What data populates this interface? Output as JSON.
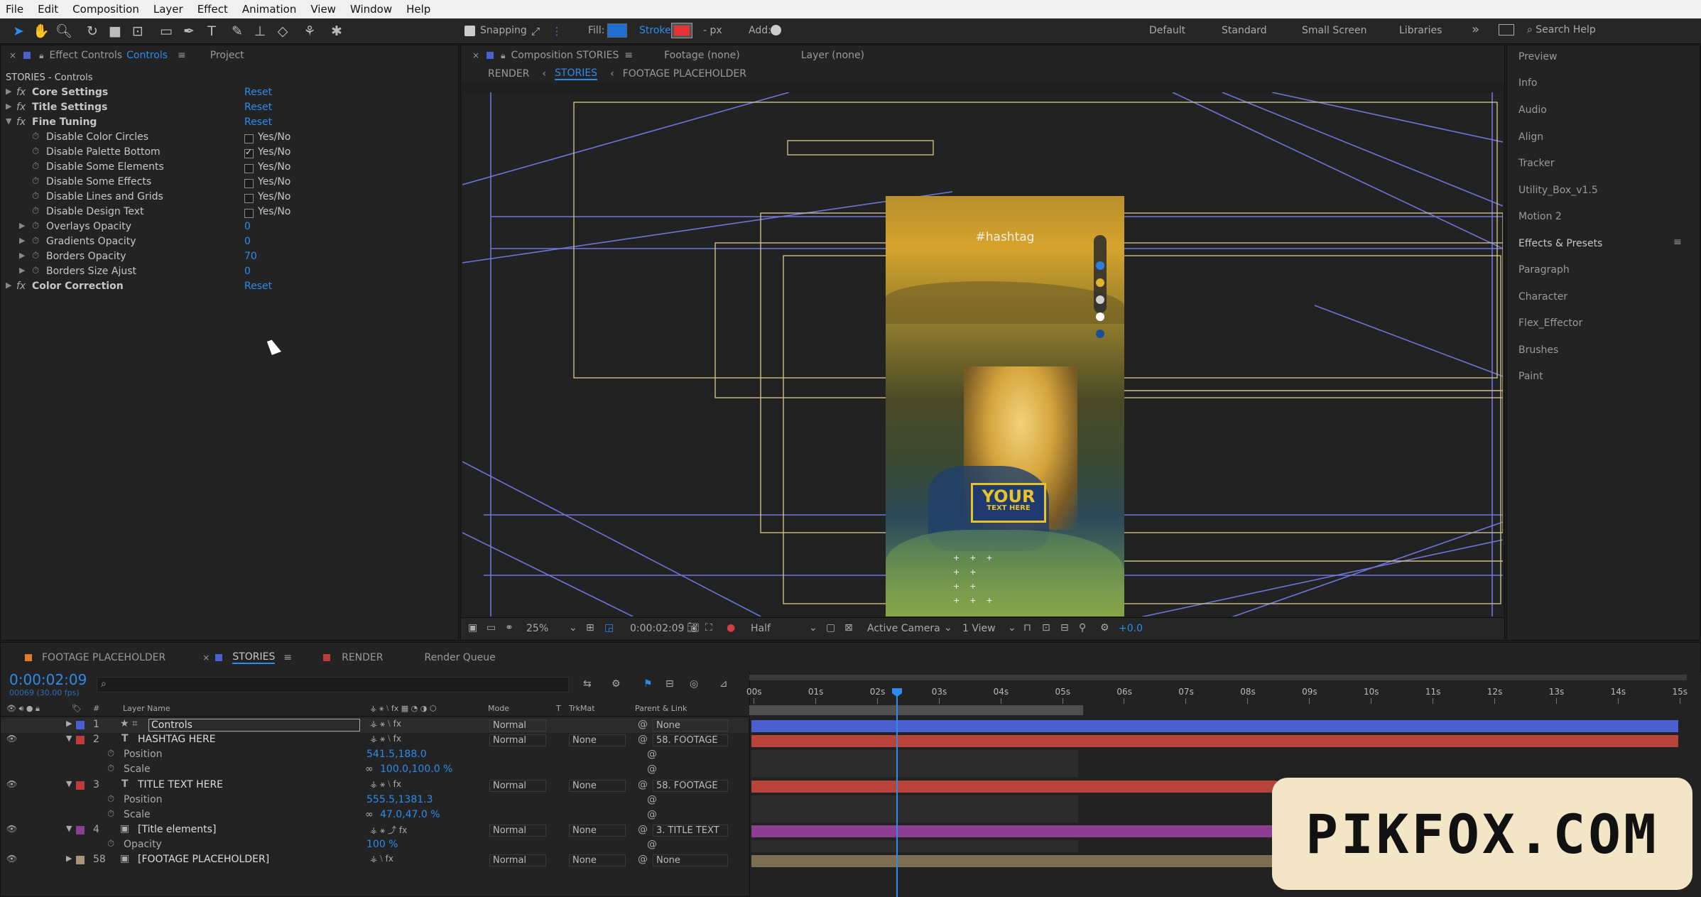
{
  "menu": [
    "File",
    "Edit",
    "Composition",
    "Layer",
    "Effect",
    "Animation",
    "View",
    "Window",
    "Help"
  ],
  "toolbar": {
    "snapping": "Snapping",
    "fill": "Fill:",
    "stroke": "Stroke:",
    "px": "- px",
    "add": "Add:",
    "workspaces": [
      "Default",
      "Standard",
      "Small Screen",
      "Libraries"
    ],
    "search": "Search Help"
  },
  "effect_controls": {
    "tab_prefix": "Effect Controls",
    "tab_name": "Controls",
    "project_tab": "Project",
    "path": "STORIES - Controls",
    "rows": [
      {
        "label": "Core Settings",
        "value": "Reset"
      },
      {
        "label": "Title Settings",
        "value": "Reset"
      },
      {
        "label": "Fine Tuning",
        "value": "Reset"
      },
      {
        "label": "Disable Color Circles",
        "value": "Yes/No"
      },
      {
        "label": "Disable Palette Bottom",
        "value": "Yes/No"
      },
      {
        "label": "Disable Some Elements",
        "value": "Yes/No"
      },
      {
        "label": "Disable Some Effects",
        "value": "Yes/No"
      },
      {
        "label": "Disable Lines and Grids",
        "value": "Yes/No"
      },
      {
        "label": "Disable Design Text",
        "value": "Yes/No"
      },
      {
        "label": "Overlays Opacity",
        "value": "0"
      },
      {
        "label": "Gradients Opacity",
        "value": "0"
      },
      {
        "label": "Borders Opacity",
        "value": "70"
      },
      {
        "label": "Borders Size Ajust",
        "value": "0"
      },
      {
        "label": "Color Correction",
        "value": "Reset"
      }
    ]
  },
  "composition": {
    "tab": "Composition STORIES",
    "footage": "Footage (none)",
    "layer": "Layer (none)",
    "crumbs": [
      "RENDER",
      "STORIES",
      "FOOTAGE PLACEHOLDER"
    ],
    "hashtag": "#hashtag",
    "your": "YOUR",
    "text_here": "TEXT HERE",
    "bottom": {
      "zoom": "25%",
      "time": "0:00:02:09",
      "res": "Half",
      "camera": "Active Camera",
      "view": "1 View",
      "exposure": "+0.0"
    }
  },
  "right_panel": [
    "Preview",
    "Info",
    "Audio",
    "Align",
    "Tracker",
    "Utility_Box_v1.5",
    "Motion 2",
    "Effects & Presets",
    "Paragraph",
    "Character",
    "Flex_Effector",
    "Brushes",
    "Paint"
  ],
  "timeline": {
    "tabs": [
      "FOOTAGE PLACEHOLDER",
      "STORIES",
      "RENDER",
      "Render Queue"
    ],
    "timecode": "0:00:02:09",
    "frames": "00069 (30.00 fps)",
    "headers": {
      "num": "#",
      "layer": "Layer Name",
      "mode": "Mode",
      "t": "T",
      "trkmat": "TrkMat",
      "parent": "Parent & Link"
    },
    "ruler": [
      "00s",
      "01s",
      "02s",
      "03s",
      "04s",
      "05s",
      "06s",
      "07s",
      "08s",
      "09s",
      "10s",
      "11s",
      "12s",
      "13s",
      "14s",
      "15s"
    ],
    "layers": [
      {
        "num": "1",
        "name": "Controls",
        "mode": "Normal",
        "trk": "",
        "parent": "None"
      },
      {
        "num": "2",
        "name": "HASHTAG HERE",
        "mode": "Normal",
        "trk": "None",
        "parent": "58. FOOTAGE"
      },
      {
        "prop": "Position",
        "value": "541.5,188.0"
      },
      {
        "prop": "Scale",
        "value": "100.0,100.0 %"
      },
      {
        "num": "3",
        "name": "TITLE TEXT HERE",
        "mode": "Normal",
        "trk": "None",
        "parent": "58. FOOTAGE"
      },
      {
        "prop": "Position",
        "value": "555.5,1381.3"
      },
      {
        "prop": "Scale",
        "value": "47.0,47.0 %"
      },
      {
        "num": "4",
        "name": "[Title elements]",
        "mode": "Normal",
        "trk": "None",
        "parent": "3. TITLE TEXT"
      },
      {
        "prop": "Opacity",
        "value": "100 %"
      },
      {
        "num": "58",
        "name": "[FOOTAGE PLACEHOLDER]",
        "mode": "Normal",
        "trk": "None",
        "parent": "None"
      }
    ]
  },
  "watermark": "PIKFOX.COM",
  "colors": {
    "accent": "#2d8ceb",
    "layer1": "#4a5fd0",
    "layer2": "#b8433b",
    "layer4": "#8c3f91",
    "layer58": "#7c6d55"
  }
}
